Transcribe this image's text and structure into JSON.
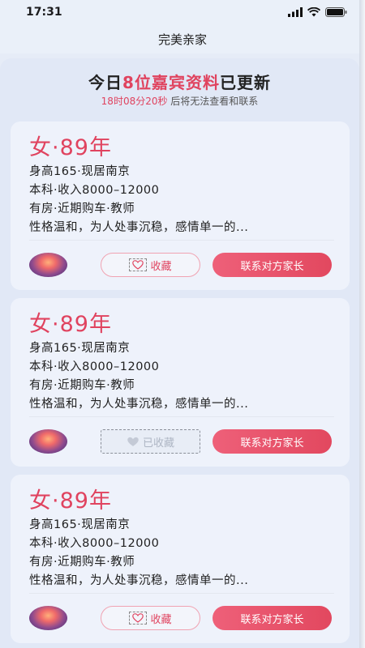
{
  "status_bar": {
    "time": "17:31"
  },
  "nav": {
    "title": "完美亲家"
  },
  "banner": {
    "headline_prefix": "今日",
    "headline_accent": "8位嘉宾资料",
    "headline_suffix": "已更新",
    "countdown": "18时08分20秒",
    "countdown_suffix": " 后将无法查看和联系"
  },
  "colors": {
    "accent": "#e0435f",
    "background": "#e6ecf7",
    "card": "#eef2fb"
  },
  "cards": [
    {
      "title": "女·89年",
      "line1": "身高165·现居南京",
      "line2": "本科·收入8000–12000",
      "line3": "有房·近期购车·教师",
      "line4": "性格温和，为人处事沉稳，感情单一的...",
      "favorite_label": "收藏",
      "favorite_icon": "heart-outline-icon",
      "contact_label": "联系对方家长"
    },
    {
      "title": "女·89年",
      "line1": "身高165·现居南京",
      "line2": "本科·收入8000–12000",
      "line3": "有房·近期购车·教师",
      "line4": "性格温和，为人处事沉稳，感情单一的...",
      "favorite_label": "已收藏",
      "favorite_icon": "heart-filled-icon",
      "contact_label": "联系对方家长"
    },
    {
      "title": "女·89年",
      "line1": "身高165·现居南京",
      "line2": "本科·收入8000–12000",
      "line3": "有房·近期购车·教师",
      "line4": "性格温和，为人处事沉稳，感情单一的...",
      "favorite_label": "收藏",
      "favorite_icon": "heart-outline-icon",
      "contact_label": "联系对方家长"
    }
  ]
}
